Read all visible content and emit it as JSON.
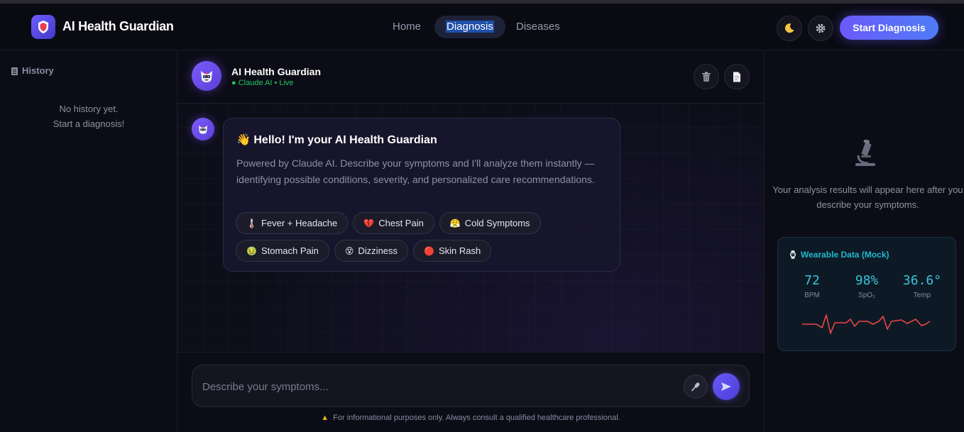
{
  "app": {
    "brand": "AI Health Guardian"
  },
  "nav": {
    "home": "Home",
    "diagnosis": "Diagnosis",
    "diseases": "Diseases",
    "start": "Start Diagnosis"
  },
  "history": {
    "title": "History",
    "empty_line1": "No history yet.",
    "empty_line2": "Start a diagnosis!"
  },
  "chat": {
    "name": "AI Health Guardian",
    "status": "● Claude AI • Live",
    "greeting": "👋 Hello! I'm your AI Health Guardian",
    "intro": "Powered by Claude AI. Describe your symptoms and I'll analyze them instantly — identifying possible conditions, severity, and personalized care recommendations.",
    "chips": [
      {
        "icon": "🌡️",
        "label": "Fever + Headache"
      },
      {
        "icon": "💔",
        "label": "Chest Pain"
      },
      {
        "icon": "😤",
        "label": "Cold Symptoms"
      },
      {
        "icon": "🤢",
        "label": "Stomach Pain"
      },
      {
        "icon": "😵",
        "label": "Dizziness"
      },
      {
        "icon": "🔴",
        "label": "Skin Rash"
      }
    ],
    "placeholder": "Describe your symptoms...",
    "disclaimer": "For informational purposes only. Always consult a qualified healthcare professional."
  },
  "results": {
    "empty_text": "Your analysis results will appear here after you describe your symptoms."
  },
  "wearable": {
    "title": "Wearable Data (Mock)",
    "bpm_value": "72",
    "bpm_label": "BPM",
    "spo2_value": "98%",
    "spo2_label": "SpO₂",
    "temp_value": "36.6°",
    "temp_label": "Temp"
  },
  "colors": {
    "accent": "#6a5af9",
    "live": "#22c55e",
    "wearable": "#22b8cf",
    "ecg": "#ef4444"
  }
}
